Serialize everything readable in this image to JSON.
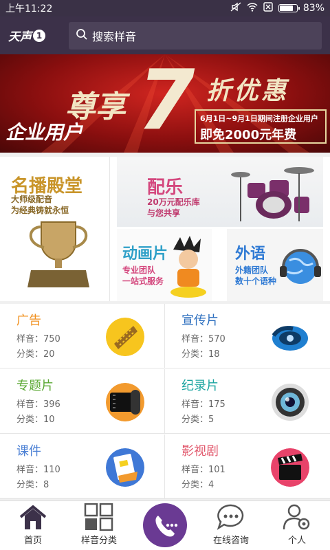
{
  "status_bar": {
    "time": "上午11:22",
    "battery": "83%",
    "battery_level": 0.83
  },
  "header": {
    "logo_text": "天声",
    "logo_number": "1",
    "search_placeholder": "搜索样音"
  },
  "banner": {
    "headline_1": "尊享",
    "headline_number": "7",
    "headline_2": "折优惠",
    "audience": "企业用户",
    "promo_line_1": "6月1日~9月1日期间注册企业用户",
    "promo_line_2": "即免2000元年费"
  },
  "features": {
    "star": {
      "title": "名播殿堂",
      "line1": "大师级配音",
      "line2": "为经典铸就永恒"
    },
    "music": {
      "title": "配乐",
      "line1": "20万元配乐库",
      "line2": "与您共享"
    },
    "anim": {
      "title": "动画片",
      "line1": "专业团队",
      "line2": "一站式服务"
    },
    "lang": {
      "title": "外语",
      "line1": "外籍团队",
      "line2": "数十个语种"
    }
  },
  "categories": [
    {
      "name": "广告",
      "samples": "样音：750",
      "classes": "分类：20",
      "color": "#f0901e"
    },
    {
      "name": "宣传片",
      "samples": "样音：570",
      "classes": "分类：18",
      "color": "#2d6fbf"
    },
    {
      "name": "专题片",
      "samples": "样音：396",
      "classes": "分类：10",
      "color": "#5aa832"
    },
    {
      "name": "纪录片",
      "samples": "样音：175",
      "classes": "分类：5",
      "color": "#1aa4a0"
    },
    {
      "name": "课件",
      "samples": "样音：110",
      "classes": "分类：8",
      "color": "#4a7fd4"
    },
    {
      "name": "影视剧",
      "samples": "样音：101",
      "classes": "分类：4",
      "color": "#e25a6e"
    }
  ],
  "bottom_nav": {
    "home": "首页",
    "samples": "样音分类",
    "consult": "在线咨询",
    "profile": "个人"
  },
  "colors": {
    "header": "#3c3149",
    "accent_purple": "#6a3a93",
    "banner_red": "#c0201c"
  }
}
